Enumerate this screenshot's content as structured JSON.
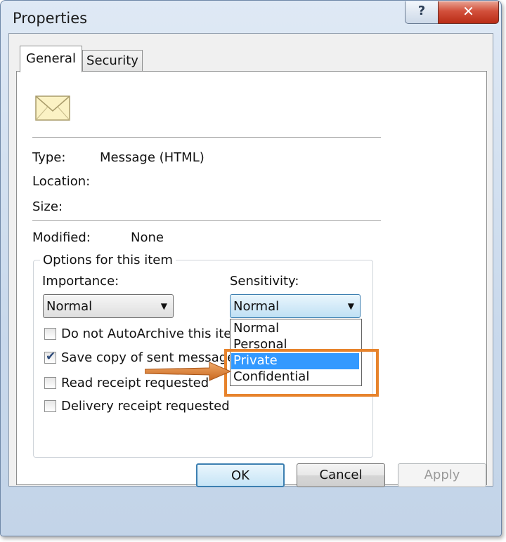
{
  "window": {
    "title": "Properties",
    "help_label": "?",
    "close_label": "✕"
  },
  "tabs": [
    {
      "label": "General",
      "active": true
    },
    {
      "label": "Security",
      "active": false
    }
  ],
  "icon": "envelope-icon",
  "info": {
    "type_label": "Type:",
    "type_value": "Message  (HTML)",
    "location_label": "Location:",
    "size_label": "Size:",
    "modified_label": "Modified:",
    "modified_value": "None"
  },
  "options": {
    "legend": "Options for this item",
    "importance_label": "Importance:",
    "importance_value": "Normal",
    "sensitivity_label": "Sensitivity:",
    "sensitivity_value": "Normal",
    "sensitivity_options": [
      "Normal",
      "Personal",
      "Private",
      "Confidential"
    ],
    "sensitivity_highlighted": "Private",
    "checkboxes": [
      {
        "label": "Do not AutoArchive this item",
        "checked": false
      },
      {
        "label": "Save copy of sent message",
        "checked": true
      },
      {
        "label": "Read receipt requested",
        "checked": false
      },
      {
        "label": "Delivery receipt requested",
        "checked": false
      }
    ]
  },
  "buttons": {
    "ok": "OK",
    "cancel": "Cancel",
    "apply": "Apply"
  },
  "colors": {
    "highlight_box": "#e7832c",
    "selected_item": "#3399ff"
  }
}
